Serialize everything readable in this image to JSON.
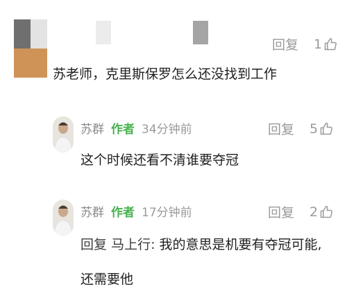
{
  "top_comment": {
    "text": "苏老师，克里斯保罗怎么还没找到工作",
    "reply_label": "回复",
    "likes": "1"
  },
  "replies": [
    {
      "author": "苏群",
      "tag": "作者",
      "time": "34分钟前",
      "text": "这个时候还看不清谁要夺冠",
      "reply_label": "回复",
      "likes": "5"
    },
    {
      "author": "苏群",
      "tag": "作者",
      "time": "17分钟前",
      "prefix": "回复",
      "mention": "马上行:",
      "text_line1": "我的意思是机要有夺冠可能,",
      "text_line2": "还需要他",
      "reply_label": "回复",
      "likes": "2"
    }
  ]
}
